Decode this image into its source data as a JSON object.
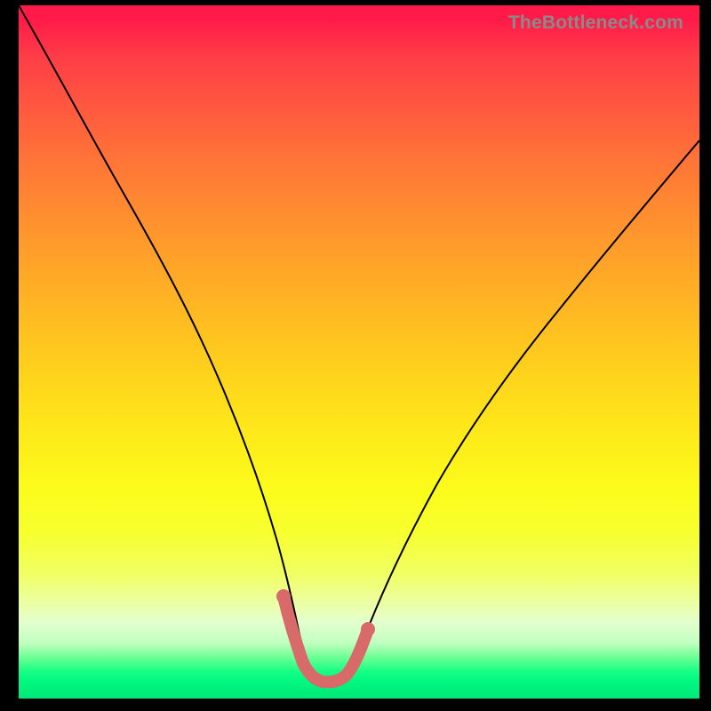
{
  "watermark": "TheBottleneck.com",
  "chart_data": {
    "type": "line",
    "title": "",
    "xlabel": "",
    "ylabel": "",
    "xlim": [
      0,
      100
    ],
    "ylim": [
      0,
      100
    ],
    "series": [
      {
        "name": "bottleneck-curve",
        "x": [
          0,
          5,
          10,
          15,
          19,
          23,
          27,
          30,
          33,
          35,
          37,
          39,
          40.5,
          42,
          43.5,
          45,
          46,
          47,
          48,
          50,
          53,
          56,
          60,
          66,
          74,
          84,
          94,
          100
        ],
        "y": [
          100,
          92,
          83,
          74,
          65,
          56,
          47,
          39,
          31,
          25,
          19,
          13,
          8,
          5,
          3.5,
          3,
          3,
          3.5,
          5,
          8,
          14,
          20,
          28,
          39,
          52,
          66,
          79,
          85
        ]
      },
      {
        "name": "highlighted-optimal-range",
        "x": [
          39,
          40.5,
          42,
          43.5,
          45,
          46,
          47,
          48
        ],
        "y": [
          13,
          8,
          5,
          3.5,
          3,
          3,
          3.5,
          5
        ]
      }
    ],
    "colors": {
      "curve": "#000000",
      "highlight": "#d86a6a",
      "background_gradient": [
        "#ff1a49",
        "#ffea1a",
        "#00e879"
      ]
    }
  }
}
